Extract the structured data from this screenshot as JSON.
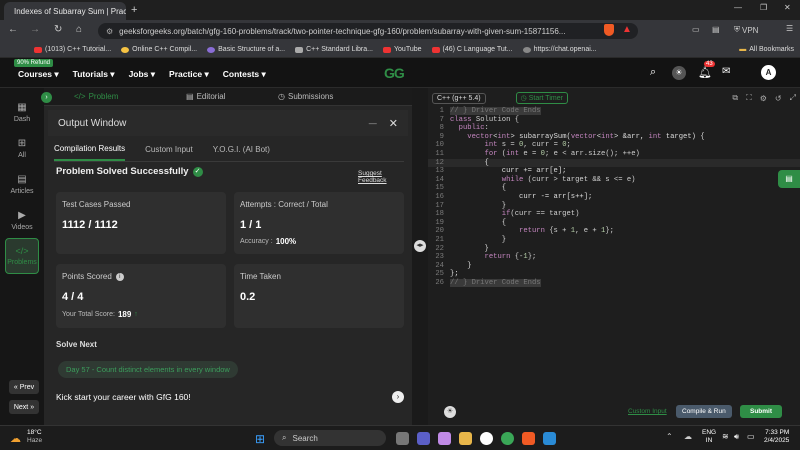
{
  "browser": {
    "tab_title": "Indexes of Subarray Sum | Prac",
    "url": "geeksforgeeks.org/batch/gfg-160-problems/track/two-pointer-technique-gfg-160/problem/subarray-with-given-sum-15871156...",
    "vpn": "VPN",
    "bookmarks": [
      "(1013) C++ Tutorial...",
      "Online C++ Compil...",
      "Basic Structure of a...",
      "C++ Standard Libra...",
      "YouTube",
      "(46) C Language Tut...",
      "https://chat.openai..."
    ],
    "all_bookmarks": "All Bookmarks"
  },
  "site": {
    "badge": "90% Refund",
    "nav": [
      "Courses",
      "Tutorials",
      "Jobs",
      "Practice",
      "Contests"
    ],
    "logo": "GG",
    "notif_count": "43",
    "avatar": "A"
  },
  "rail": {
    "items": [
      "Dash",
      "All",
      "Articles",
      "Videos",
      "Problems"
    ],
    "prev": "Prev",
    "next": "Next"
  },
  "panel": {
    "tabs": [
      "Problem",
      "Editorial",
      "Submissions"
    ],
    "output_title": "Output Window",
    "subtabs": [
      "Compilation Results",
      "Custom Input",
      "Y.O.G.I. (AI Bot)"
    ],
    "status": "Problem Solved Successfully",
    "suggest": "Suggest Feedback",
    "tests_label": "Test Cases Passed",
    "tests_value": "1112 / 1112",
    "attempts_label": "Attempts : Correct / Total",
    "attempts_value": "1 / 1",
    "accuracy_label": "Accuracy :",
    "accuracy_value": "100%",
    "points_label": "Points Scored",
    "points_value": "4 / 4",
    "total_label": "Your Total Score:",
    "total_value": "189",
    "time_label": "Time Taken",
    "time_value": "0.2",
    "solve_next": "Solve Next",
    "next_problem": "Day 57 - Count distinct elements in every window",
    "kickstart": "Kick start your career with GfG 160!"
  },
  "editor": {
    "lang": "C++ (g++ 5.4)",
    "timer": "Start Timer",
    "lines": [
      {
        "n": "1",
        "t": "// } Driver Code Ends"
      },
      {
        "n": "7",
        "t": "class Solution {"
      },
      {
        "n": "8",
        "t": "  public:"
      },
      {
        "n": "9",
        "t": "    vector<int> subarraySum(vector<int> &arr, int target) {"
      },
      {
        "n": "10",
        "t": "        int s = 0, curr = 0;"
      },
      {
        "n": "11",
        "t": "        for (int e = 0; e < arr.size(); ++e)"
      },
      {
        "n": "12",
        "t": "        {"
      },
      {
        "n": "13",
        "t": "            curr += arr[e];"
      },
      {
        "n": "14",
        "t": "            while (curr > target && s <= e)"
      },
      {
        "n": "15",
        "t": "            {"
      },
      {
        "n": "16",
        "t": "                curr -= arr[s++];"
      },
      {
        "n": "17",
        "t": "            }"
      },
      {
        "n": "18",
        "t": "            if(curr == target)"
      },
      {
        "n": "19",
        "t": "            {"
      },
      {
        "n": "20",
        "t": "                return {s + 1, e + 1};"
      },
      {
        "n": "21",
        "t": "            }"
      },
      {
        "n": "22",
        "t": "        }"
      },
      {
        "n": "23",
        "t": "        return {-1};"
      },
      {
        "n": "24",
        "t": "    }"
      },
      {
        "n": "25",
        "t": "};"
      },
      {
        "n": "26",
        "t": "// } Driver Code Ends"
      }
    ],
    "custom_input": "Custom Input",
    "compile": "Compile & Run",
    "submit": "Submit"
  },
  "taskbar": {
    "temp": "18°C",
    "weather": "Haze",
    "search": "Search",
    "lang1": "ENG",
    "lang2": "IN",
    "time": "7:33 PM",
    "date": "2/4/2025"
  },
  "colors": {
    "green": "#2f8d46",
    "accent": "#3c9d5c"
  }
}
